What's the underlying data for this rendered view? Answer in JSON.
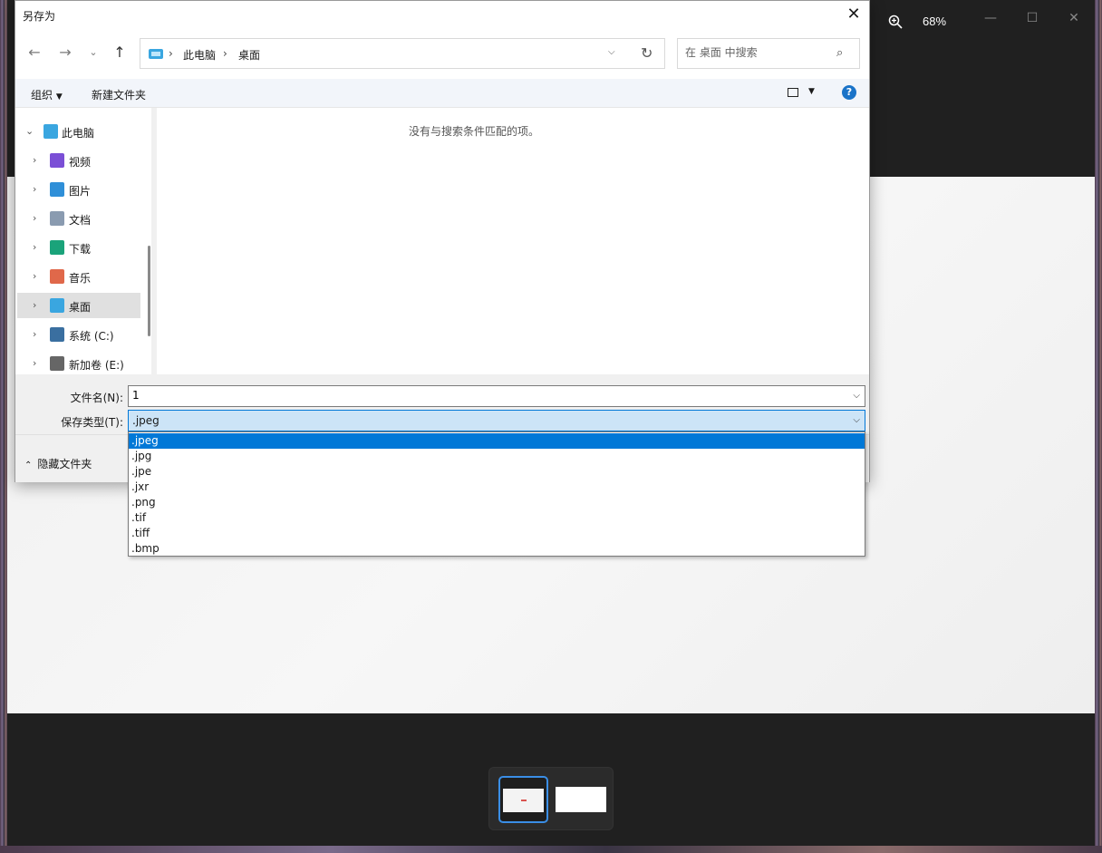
{
  "viewer": {
    "zoom_level": "68%",
    "minimize_icon": "—",
    "maximize_icon": "☐",
    "close_icon": "✕"
  },
  "dialog": {
    "title": "另存为",
    "close_icon": "✕",
    "nav": {
      "back": "←",
      "forward": "→",
      "recent": "⌄",
      "up": "↑"
    },
    "address": {
      "crumbs": [
        "此电脑",
        "桌面"
      ],
      "separator": "›"
    },
    "search_placeholder": "在 桌面 中搜索",
    "commands": {
      "organize": "组织",
      "new_folder": "新建文件夹",
      "help": "?"
    },
    "tree": [
      {
        "label": "此电脑",
        "icon_color": "#3aa6e0",
        "expanded": true
      },
      {
        "label": "视频",
        "icon_color": "#7b4fd6"
      },
      {
        "label": "图片",
        "icon_color": "#2f8fd8"
      },
      {
        "label": "文档",
        "icon_color": "#8a9bb0"
      },
      {
        "label": "下载",
        "icon_color": "#1aa37a"
      },
      {
        "label": "音乐",
        "icon_color": "#e0684a"
      },
      {
        "label": "桌面",
        "icon_color": "#3aa6e0",
        "selected": true
      },
      {
        "label": "系统 (C:)",
        "icon_color": "#3a6fa0"
      },
      {
        "label": "新加卷 (E:)",
        "icon_color": "#666666"
      }
    ],
    "empty_message": "没有与搜索条件匹配的项。",
    "file_name_label": "文件名(N):",
    "file_name_value": "1",
    "save_type_label": "保存类型(T):",
    "save_type_value": ".jpeg",
    "hide_folders": "隐藏文件夹",
    "save_type_options": [
      ".jpeg",
      ".jpg",
      ".jpe",
      ".jxr",
      ".png",
      ".tif",
      ".tiff",
      ".bmp"
    ],
    "selected_option": ".jpeg"
  },
  "colors": {
    "accent": "#0078d7",
    "viewer_bg": "#202020"
  }
}
